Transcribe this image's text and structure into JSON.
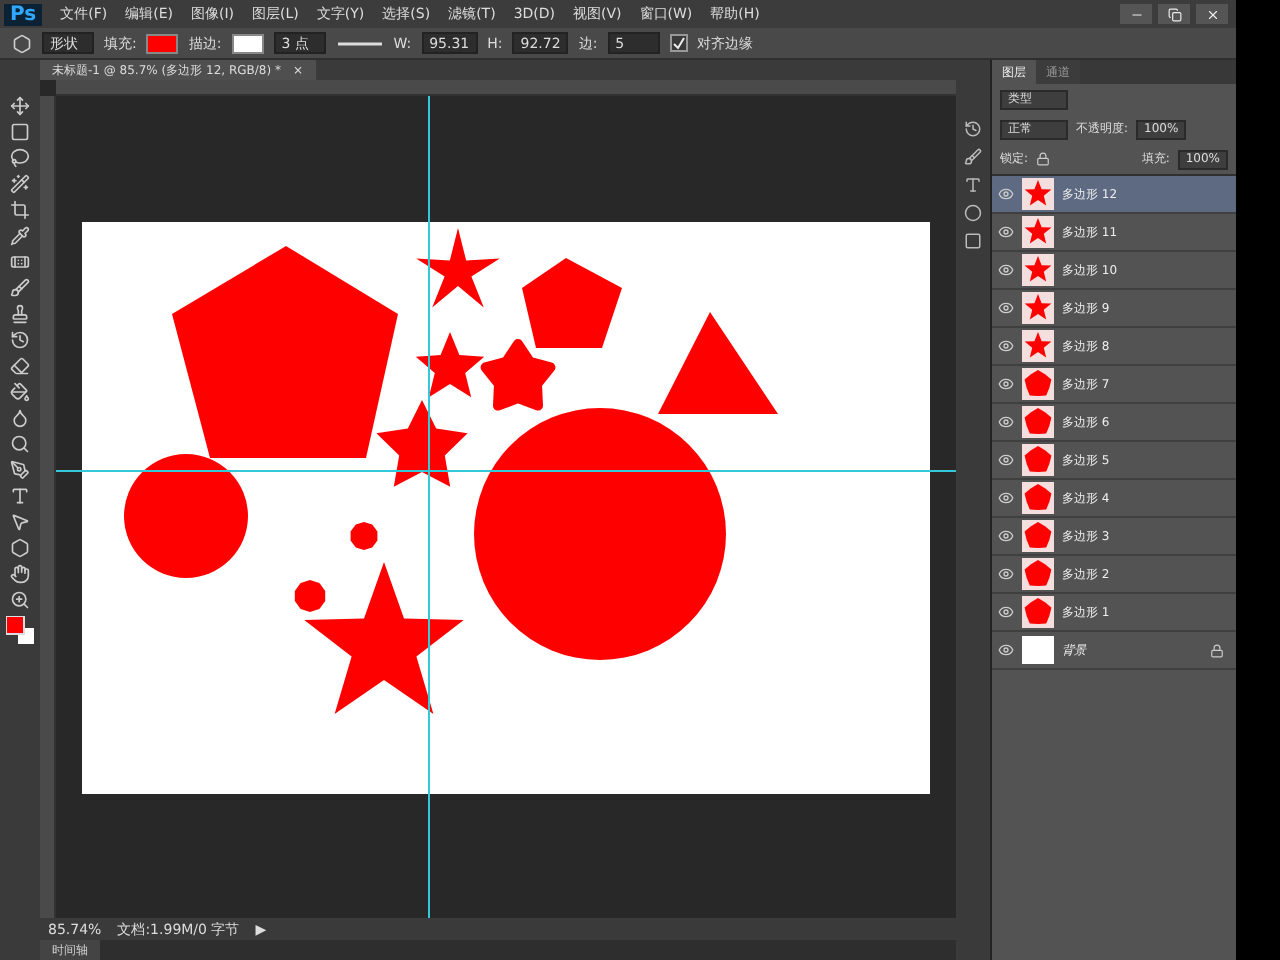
{
  "app": {
    "logo": "Ps"
  },
  "menu": [
    "文件(F)",
    "编辑(E)",
    "图像(I)",
    "图层(L)",
    "文字(Y)",
    "选择(S)",
    "滤镜(T)",
    "3D(D)",
    "视图(V)",
    "窗口(W)",
    "帮助(H)"
  ],
  "options": {
    "mode": "形状",
    "fill_label": "填充:",
    "stroke_label": "描边:",
    "stroke_width": "3 点",
    "w_label": "W:",
    "w_value": "95.31",
    "h_label": "H:",
    "h_value": "92.72",
    "sides_label": "边:",
    "sides_value": "5",
    "align_edges": {
      "label": "对齐边缘",
      "checked": true
    }
  },
  "document_tab": {
    "title": "未标题-1 @ 85.7% (多边形 12, RGB/8) *",
    "close": "×"
  },
  "panel": {
    "tabs": [
      {
        "label": "图层",
        "selected": true
      },
      {
        "label": "通道",
        "selected": false
      }
    ],
    "filter": "类型",
    "blend": "正常",
    "opacity_label": "不透明度:",
    "opacity": "100%",
    "lock_label": "锁定:",
    "fill_label": "填充:",
    "fill": "100%",
    "layers": [
      {
        "name": "多边形 12",
        "kind": "shape",
        "selected": true
      },
      {
        "name": "多边形 11",
        "kind": "shape",
        "selected": false
      },
      {
        "name": "多边形 10",
        "kind": "shape",
        "selected": false
      },
      {
        "name": "多边形 9",
        "kind": "shape",
        "selected": false
      },
      {
        "name": "多边形 8",
        "kind": "shape",
        "selected": false
      },
      {
        "name": "多边形 7",
        "kind": "shape",
        "selected": false
      },
      {
        "name": "多边形 6",
        "kind": "shape",
        "selected": false
      },
      {
        "name": "多边形 5",
        "kind": "shape",
        "selected": false
      },
      {
        "name": "多边形 4",
        "kind": "shape",
        "selected": false
      },
      {
        "name": "多边形 3",
        "kind": "shape",
        "selected": false
      },
      {
        "name": "多边形 2",
        "kind": "shape",
        "selected": false
      },
      {
        "name": "多边形 1",
        "kind": "shape",
        "selected": false
      },
      {
        "name": "背景",
        "kind": "background",
        "selected": false
      }
    ]
  },
  "status": {
    "zoom": "85.74%",
    "doc": "文档:1.99M/0 字节",
    "arrow": "▶"
  },
  "bottom_tab": "时间轴"
}
